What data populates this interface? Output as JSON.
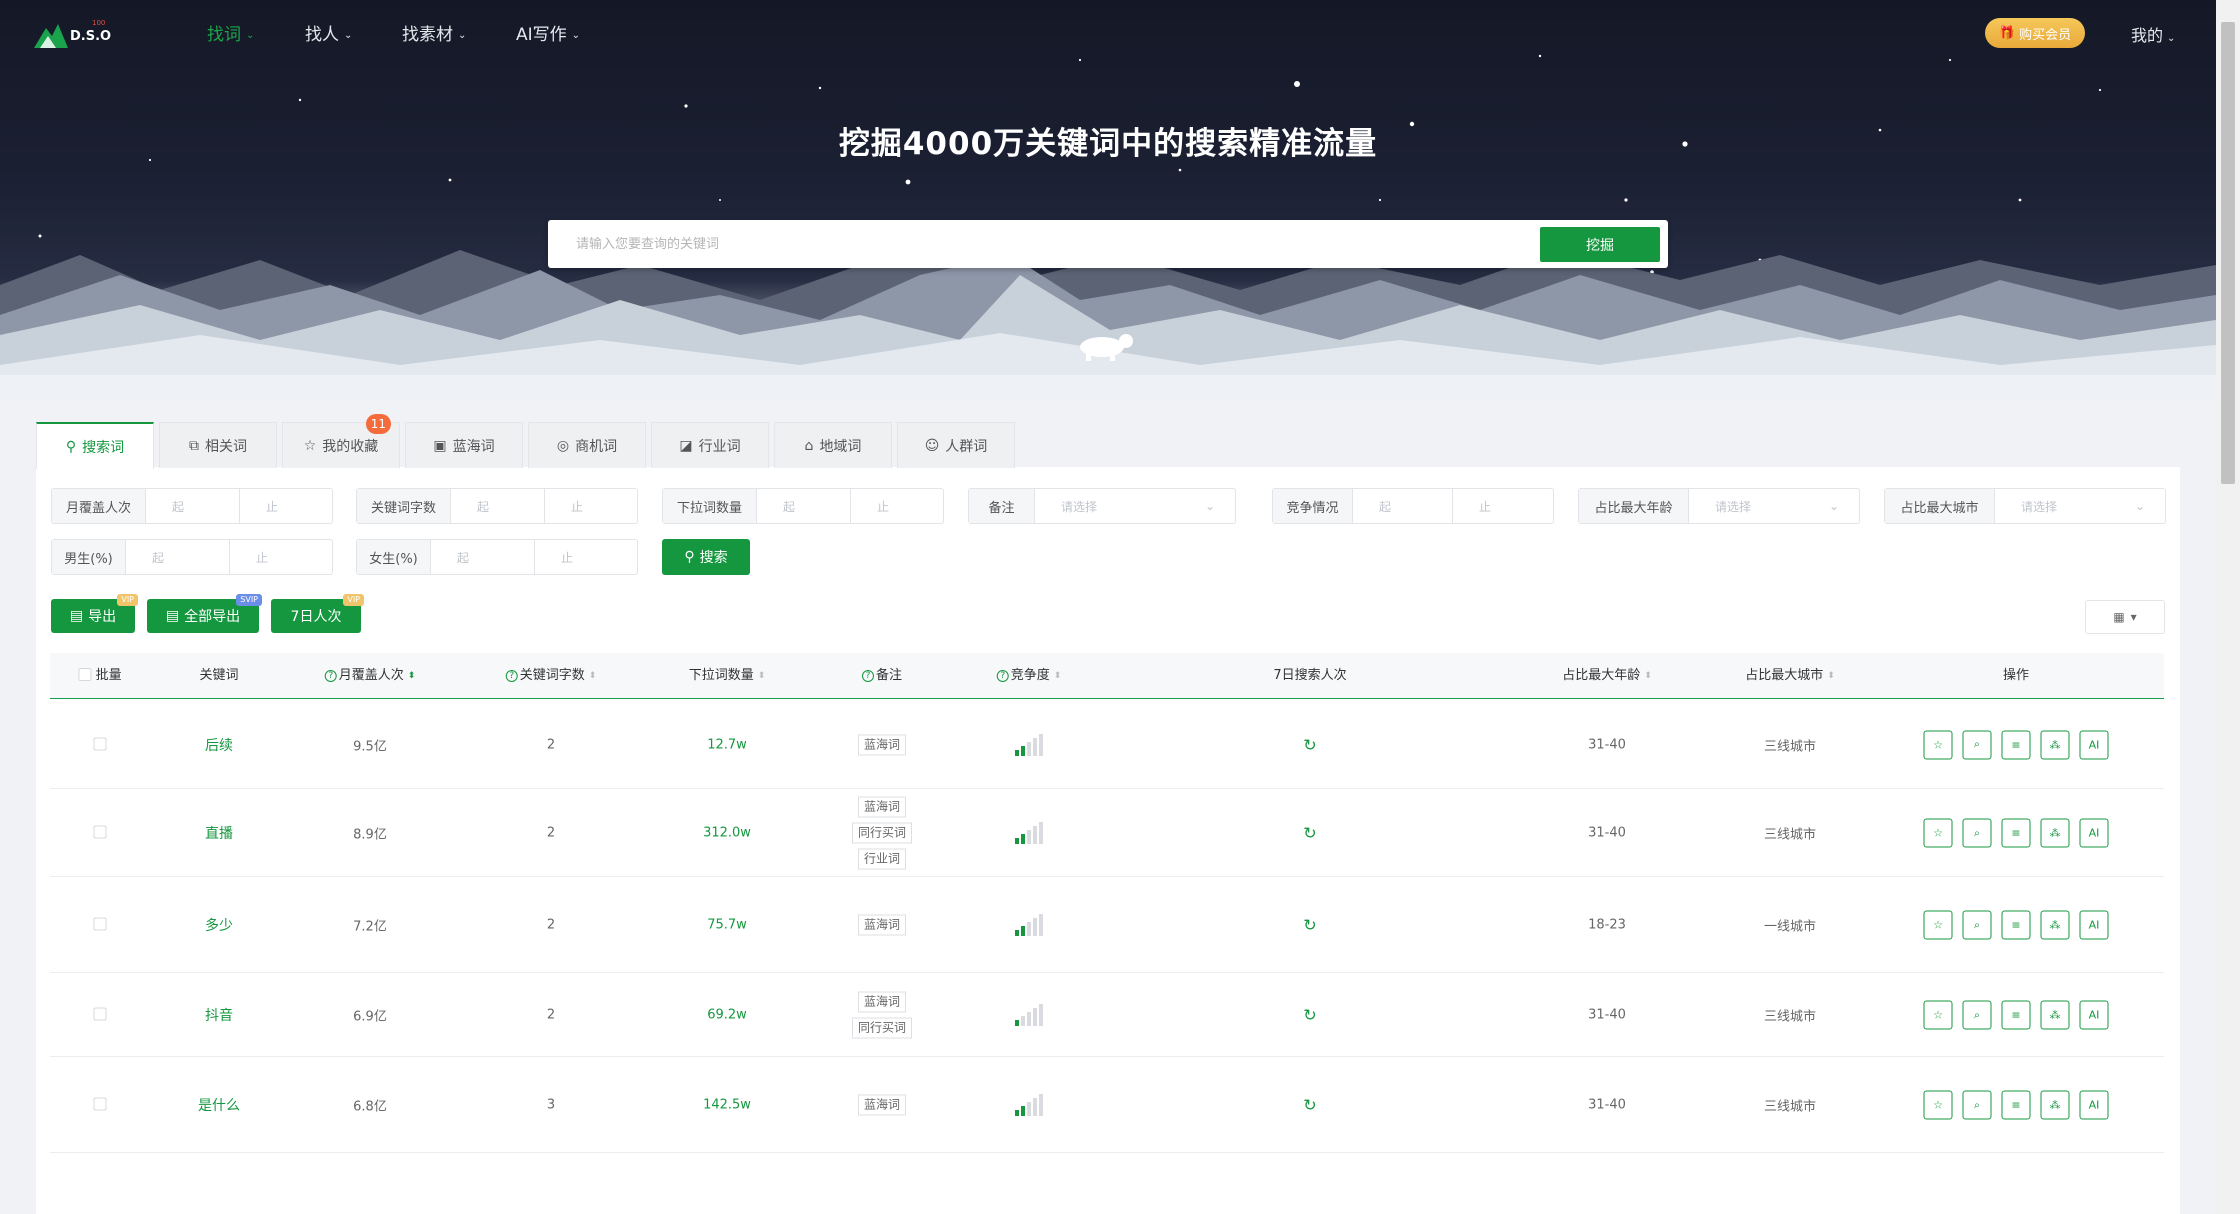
{
  "nav": {
    "logo_text": "D.S.O",
    "logo_sup": "100",
    "items": [
      {
        "label": "找词",
        "active": true
      },
      {
        "label": "找人",
        "active": false
      },
      {
        "label": "找素材",
        "active": false
      },
      {
        "label": "AI写作",
        "active": false
      }
    ],
    "vip_label": "购买会员",
    "me_label": "我的"
  },
  "hero": {
    "title": "挖掘4000万关键词中的搜索精准流量",
    "search_placeholder": "请输入您要查询的关键词",
    "search_button": "挖掘"
  },
  "tabs": [
    {
      "label": "搜索词",
      "icon": "search-icon",
      "active": true
    },
    {
      "label": "相关词",
      "icon": "copy-icon",
      "active": false
    },
    {
      "label": "我的收藏",
      "icon": "star-icon",
      "active": false,
      "badge": "11"
    },
    {
      "label": "蓝海词",
      "icon": "image-icon",
      "active": false
    },
    {
      "label": "商机词",
      "icon": "location-icon",
      "active": false
    },
    {
      "label": "行业词",
      "icon": "chart-icon",
      "active": false
    },
    {
      "label": "地域词",
      "icon": "building-icon",
      "active": false
    },
    {
      "label": "人群词",
      "icon": "people-icon",
      "active": false
    }
  ],
  "filters": {
    "range_from": "起",
    "range_to": "止",
    "select_placeholder": "请选择",
    "monthly": "月覆盖人次",
    "chars": "关键词字数",
    "dropdown": "下拉词数量",
    "remark": "备注",
    "competition": "竞争情况",
    "max_age": "占比最大年龄",
    "max_city": "占比最大城市",
    "male": "男生(%)",
    "female": "女生(%)",
    "search_button": "搜索"
  },
  "actions": {
    "export": "导出",
    "export_tag": "VIP",
    "export_all": "全部导出",
    "export_all_tag": "SVIP",
    "seven_day": "7日人次",
    "seven_day_tag": "VIP"
  },
  "table": {
    "headers": {
      "batch": "批量",
      "keyword": "关键词",
      "monthly": "月覆盖人次",
      "chars": "关键词字数",
      "dropdown": "下拉词数量",
      "remark": "备注",
      "competition": "竞争度",
      "seven_day": "7日搜索人次",
      "max_age": "占比最大年龄",
      "max_city": "占比最大城市",
      "ops": "操作"
    },
    "op_ai_label": "AI",
    "rows": [
      {
        "keyword": "后续",
        "monthly": "9.5亿",
        "chars": "2",
        "dropdown": "12.7w",
        "tags": [
          "蓝海词"
        ],
        "competition": 2,
        "age": "31-40",
        "city": "三线城市"
      },
      {
        "keyword": "直播",
        "monthly": "8.9亿",
        "chars": "2",
        "dropdown": "312.0w",
        "tags": [
          "蓝海词",
          "同行买词",
          "行业词"
        ],
        "competition": 2,
        "age": "31-40",
        "city": "三线城市"
      },
      {
        "keyword": "多少",
        "monthly": "7.2亿",
        "chars": "2",
        "dropdown": "75.7w",
        "tags": [
          "蓝海词"
        ],
        "competition": 2,
        "age": "18-23",
        "city": "一线城市"
      },
      {
        "keyword": "抖音",
        "monthly": "6.9亿",
        "chars": "2",
        "dropdown": "69.2w",
        "tags": [
          "蓝海词",
          "同行买词"
        ],
        "competition": 1,
        "age": "31-40",
        "city": "三线城市"
      },
      {
        "keyword": "是什么",
        "monthly": "6.8亿",
        "chars": "3",
        "dropdown": "142.5w",
        "tags": [
          "蓝海词"
        ],
        "competition": 2,
        "age": "31-40",
        "city": "三线城市"
      }
    ]
  },
  "colors": {
    "brand_green": "#15973f",
    "vip_gold": "#e8a93a",
    "badge_orange": "#f56c3c",
    "night_sky": "#141826"
  }
}
